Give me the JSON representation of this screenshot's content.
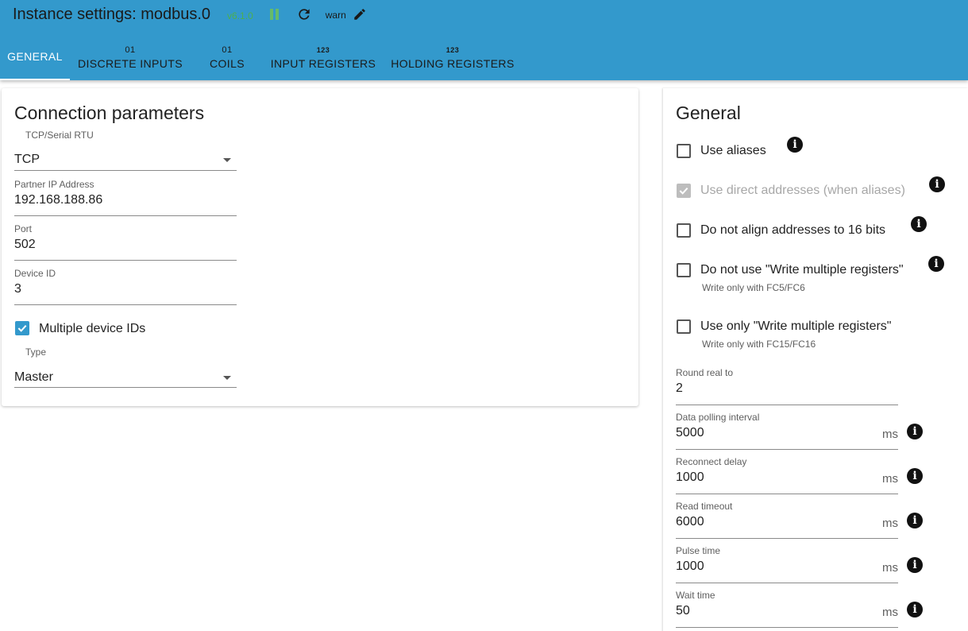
{
  "header": {
    "title": "Instance settings: modbus.0",
    "version": "v6.1.0",
    "log_level": "warn",
    "icons": {
      "pause": "pause-icon",
      "reload": "reload-icon",
      "edit": "edit-icon"
    },
    "accent_color": "#3399cc"
  },
  "tabs": [
    {
      "badge": "",
      "label": "GENERAL",
      "active": true
    },
    {
      "badge": "01",
      "label": "DISCRETE INPUTS"
    },
    {
      "badge": "01",
      "label": "COILS"
    },
    {
      "badge": "123",
      "label": "INPUT REGISTERS"
    },
    {
      "badge": "123",
      "label": "HOLDING REGISTERS"
    }
  ],
  "connection": {
    "title": "Connection parameters",
    "transport": {
      "label": "TCP/Serial RTU",
      "value": "TCP"
    },
    "partner_ip": {
      "label": "Partner IP Address",
      "value": "192.168.188.86"
    },
    "port": {
      "label": "Port",
      "value": "502"
    },
    "device_id": {
      "label": "Device ID",
      "value": "3"
    },
    "multiple_ids": {
      "label": "Multiple device IDs",
      "checked": true
    },
    "type": {
      "label": "Type",
      "value": "Master"
    }
  },
  "general": {
    "title": "General",
    "use_aliases": {
      "label": "Use aliases",
      "checked": false
    },
    "use_direct": {
      "label": "Use direct addresses (when aliases)",
      "checked": true,
      "disabled": true
    },
    "no_align": {
      "label": "Do not align addresses to 16 bits",
      "checked": false
    },
    "no_write_multiple": {
      "label": "Do not use \"Write multiple registers\"",
      "help": "Write only with FC5/FC6",
      "checked": false
    },
    "only_write_multiple": {
      "label": "Use only \"Write multiple registers\"",
      "help": "Write only with FC15/FC16",
      "checked": false
    },
    "round_real": {
      "label": "Round real to",
      "value": "2"
    },
    "poll": {
      "label": "Data polling interval",
      "value": "5000",
      "unit": "ms"
    },
    "reconnect": {
      "label": "Reconnect delay",
      "value": "1000",
      "unit": "ms"
    },
    "read_timeout": {
      "label": "Read timeout",
      "value": "6000",
      "unit": "ms"
    },
    "pulse_time": {
      "label": "Pulse time",
      "value": "1000",
      "unit": "ms"
    },
    "wait_time": {
      "label": "Wait time",
      "value": "50",
      "unit": "ms"
    }
  }
}
